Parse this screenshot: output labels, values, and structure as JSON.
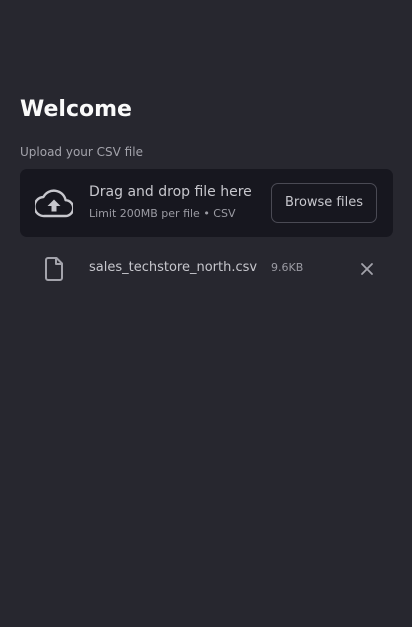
{
  "page": {
    "title": "Welcome"
  },
  "uploader": {
    "label": "Upload your CSV file",
    "drop_title": "Drag and drop file here",
    "drop_subtitle": "Limit 200MB per file • CSV",
    "browse_label": "Browse files",
    "upload_icon": "cloud-upload-icon"
  },
  "uploaded_file": {
    "name": "sales_techstore_north.csv",
    "size": "9.6KB",
    "file_icon": "file-icon",
    "remove_icon": "close-icon"
  },
  "colors": {
    "background": "#27272f",
    "dropzone": "#17171f",
    "text_primary": "#fafafa",
    "text_secondary": "#a3a3ab"
  }
}
